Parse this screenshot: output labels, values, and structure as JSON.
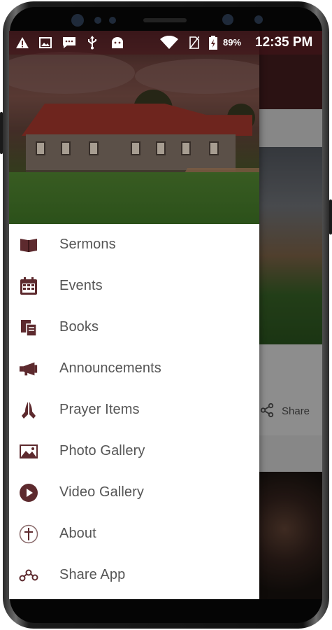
{
  "status_bar": {
    "battery_percent": "89%",
    "time": "12:35 PM",
    "icons": [
      "warning-icon",
      "image-icon",
      "message-icon",
      "usb-icon",
      "android-icon",
      "wifi-icon",
      "no-sim-icon",
      "battery-charging-icon"
    ]
  },
  "background_app": {
    "share_label": "Share"
  },
  "drawer": {
    "menu": [
      {
        "label": "Sermons",
        "icon": "open-book-icon"
      },
      {
        "label": "Events",
        "icon": "calendar-icon"
      },
      {
        "label": "Books",
        "icon": "books-icon"
      },
      {
        "label": "Announcements",
        "icon": "megaphone-icon"
      },
      {
        "label": "Prayer Items",
        "icon": "praying-hands-icon"
      },
      {
        "label": "Photo Gallery",
        "icon": "photo-icon"
      },
      {
        "label": "Video Gallery",
        "icon": "play-circle-icon"
      },
      {
        "label": "About",
        "icon": "cross-circle-icon"
      },
      {
        "label": "Share App",
        "icon": "share-icon"
      }
    ]
  },
  "colors": {
    "accent": "#5d2a2e",
    "menu_text": "#555555",
    "header_tint": "#4a1f22"
  }
}
